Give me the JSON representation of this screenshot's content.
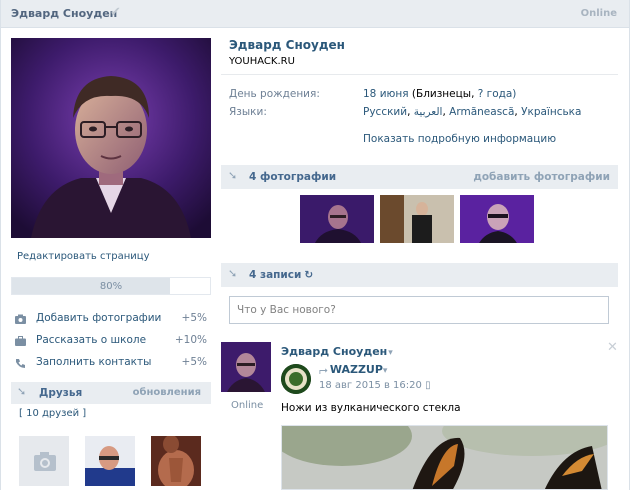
{
  "header": {
    "name": "Эдвард Сноуден",
    "status": "Online",
    "verified_icon": "checkmark-icon"
  },
  "profile": {
    "name": "Эдвард Сноуден",
    "status_text": "YOUHACK.RU",
    "birthday_label": "День рождения:",
    "birthday_date": "18 июня",
    "birthday_sign": "(Близнецы,",
    "birthday_year": "? года)",
    "languages_label": "Языки:",
    "languages": [
      "Русский",
      "العربية",
      "Armãneascã",
      "Українська"
    ],
    "more_link": "Показать подробную информацию"
  },
  "sidebar": {
    "edit_link": "Редактировать страницу",
    "progress": {
      "value": 0.8,
      "label": "80%"
    },
    "tasks": [
      {
        "icon": "camera-icon",
        "label": "Добавить фотографии",
        "bonus": "+5%"
      },
      {
        "icon": "briefcase-icon",
        "label": "Рассказать о школе",
        "bonus": "+10%"
      },
      {
        "icon": "phone-icon",
        "label": "Заполнить контакты",
        "bonus": "+5%"
      }
    ],
    "friends": {
      "title": "Друзья",
      "updates": "обновления",
      "count": "[ 10 друзей ]"
    },
    "online_label": "Online"
  },
  "photos_section": {
    "title": "4 фотографии",
    "action": "добавить фотографии"
  },
  "posts_section": {
    "title": "4 записи",
    "refresh_icon": "refresh-icon",
    "input_placeholder": "Что у Вас нового?"
  },
  "post": {
    "author": "Эдвард Сноуден",
    "author_caret": "▾",
    "repost_from": "WAZZUP",
    "repost_caret": "▾",
    "date": "18 авг 2015 в 16:20",
    "text": "Ножи из вулканического стекла"
  },
  "colors": {
    "link": "#2b587a",
    "header_bg": "#e9edf1",
    "muted": "#8fa3b6",
    "avatar_tint": "#4a1f6a"
  }
}
